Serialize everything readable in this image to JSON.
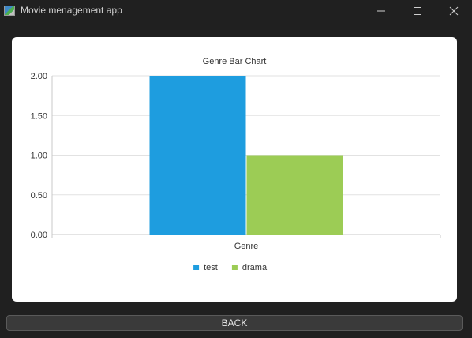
{
  "window": {
    "title": "Movie menagement app"
  },
  "chart_data": {
    "type": "bar",
    "title": "Genre Bar Chart",
    "categories": [
      "Genre"
    ],
    "series": [
      {
        "name": "test",
        "values": [
          2
        ],
        "color": "#1e9ddf"
      },
      {
        "name": "drama",
        "values": [
          1
        ],
        "color": "#9ccc55"
      }
    ],
    "ylim": [
      0,
      2
    ],
    "yticks": [
      "0.00",
      "0.50",
      "1.00",
      "1.50",
      "2.00"
    ],
    "grid": true,
    "legend": "bottom"
  },
  "footer": {
    "back_label": "BACK"
  }
}
